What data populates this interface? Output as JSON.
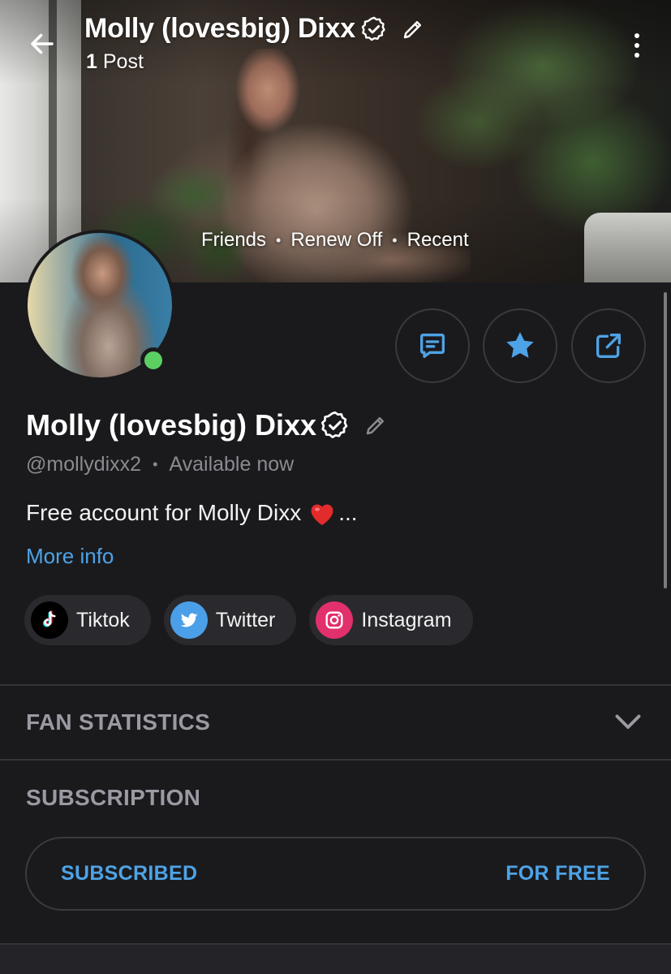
{
  "header": {
    "title": "Molly (lovesbig) Dixx",
    "posts_count": "1",
    "posts_label": "Post",
    "back_icon": "arrow-left-icon",
    "verified_icon": "verified-badge-icon",
    "edit_icon": "pencil-icon",
    "menu_icon": "more-vertical-icon"
  },
  "cover": {
    "meta": [
      "Friends",
      "Renew Off",
      "Recent"
    ]
  },
  "actions": [
    {
      "name": "message",
      "icon": "message-icon"
    },
    {
      "name": "favorite",
      "icon": "star-icon"
    },
    {
      "name": "share",
      "icon": "share-icon"
    }
  ],
  "profile": {
    "name": "Molly (lovesbig) Dixx",
    "handle": "@mollydixx2",
    "availability": "Available now",
    "bio": "Free account for Molly Dixx",
    "bio_suffix": "...",
    "more_info": "More info",
    "status": "online"
  },
  "social_links": [
    {
      "label": "Tiktok",
      "icon": "tiktok-icon"
    },
    {
      "label": "Twitter",
      "icon": "twitter-icon"
    },
    {
      "label": "Instagram",
      "icon": "instagram-icon"
    }
  ],
  "sections": {
    "fan_statistics": "FAN STATISTICS",
    "subscription": "SUBSCRIPTION",
    "subscribed_label": "SUBSCRIBED",
    "price_label": "FOR FREE"
  },
  "colors": {
    "background": "#1a1a1d",
    "accent": "#4ea3e6",
    "online": "#5ccf63",
    "muted": "#8a8a90"
  }
}
